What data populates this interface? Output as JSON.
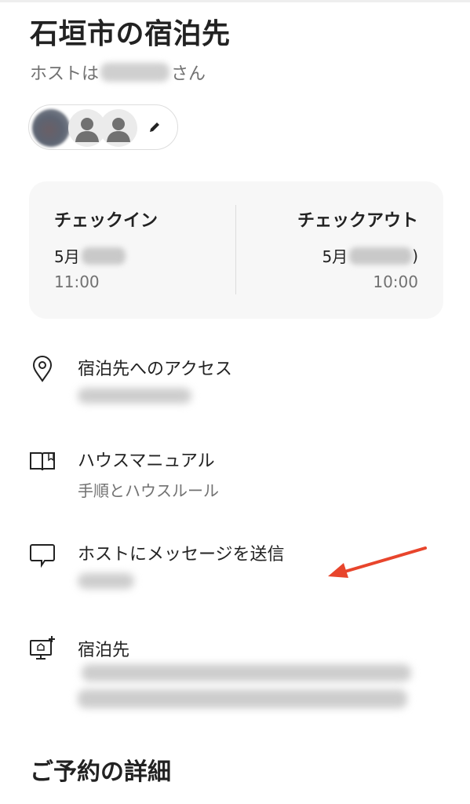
{
  "title": "石垣市の宿泊先",
  "host": {
    "prefix": "ホストは",
    "suffix": "さん"
  },
  "dates": {
    "checkin": {
      "label": "チェックイン",
      "date_visible": "5月",
      "time": "11:00"
    },
    "checkout": {
      "label": "チェックアウト",
      "date_visible": "5月",
      "date_end": ")",
      "time": "10:00"
    }
  },
  "menu": {
    "access": {
      "label": "宿泊先へのアクセス"
    },
    "manual": {
      "label": "ハウスマニュアル",
      "sub": "手順とハウスルール"
    },
    "message": {
      "label": "ホストにメッセージを送信"
    },
    "listing": {
      "label": "宿泊先"
    }
  },
  "section_title": "ご予約の詳細",
  "colors": {
    "annotation_arrow": "#e8452c",
    "muted_text": "#717171",
    "card_bg": "#f7f7f7"
  }
}
